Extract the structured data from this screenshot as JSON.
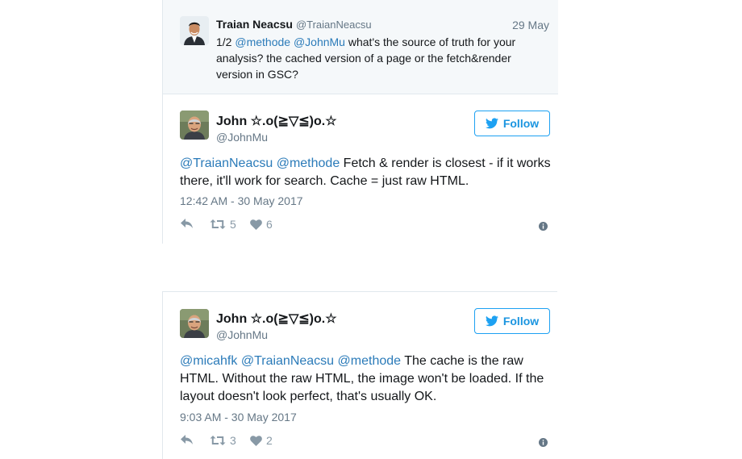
{
  "tweet1": {
    "parent": {
      "name": "Traian Neacsu",
      "handle": "@TraianNeacsu",
      "date": "29 May",
      "text_prefix": "1/2 ",
      "mention1": "@methode",
      "mention2": "@JohnMu",
      "text_rest": " what's the source of truth for your analysis? the cached version of a page or the fetch&render version in GSC?"
    },
    "author": {
      "name": "John ☆.o(≧▽≦)o.☆",
      "handle": "@JohnMu"
    },
    "follow_label": "Follow",
    "mention1": "@TraianNeacsu",
    "mention2": "@methode",
    "text_rest": " Fetch & render is closest - if it works there, it'll work for search. Cache = just raw HTML.",
    "timestamp": "12:42 AM - 30 May 2017",
    "retweets": "5",
    "likes": "6"
  },
  "tweet2": {
    "author": {
      "name": "John ☆.o(≧▽≦)o.☆",
      "handle": "@JohnMu"
    },
    "follow_label": "Follow",
    "mention1": "@micahfk",
    "mention2": "@TraianNeacsu",
    "mention3": "@methode",
    "text_rest": " The cache is the raw HTML. Without the raw HTML, the image won't be loaded. If the layout doesn't look perfect, that's usually OK.",
    "timestamp": "9:03 AM - 30 May 2017",
    "retweets": "3",
    "likes": "2"
  },
  "colors": {
    "link": "#2b7bb9",
    "twitter_blue": "#1da1f2",
    "muted": "#657786",
    "parent_bg": "#f5f8fa"
  },
  "icons": [
    "reply-icon",
    "retweet-icon",
    "heart-icon",
    "info-icon",
    "twitter-bird-icon"
  ]
}
